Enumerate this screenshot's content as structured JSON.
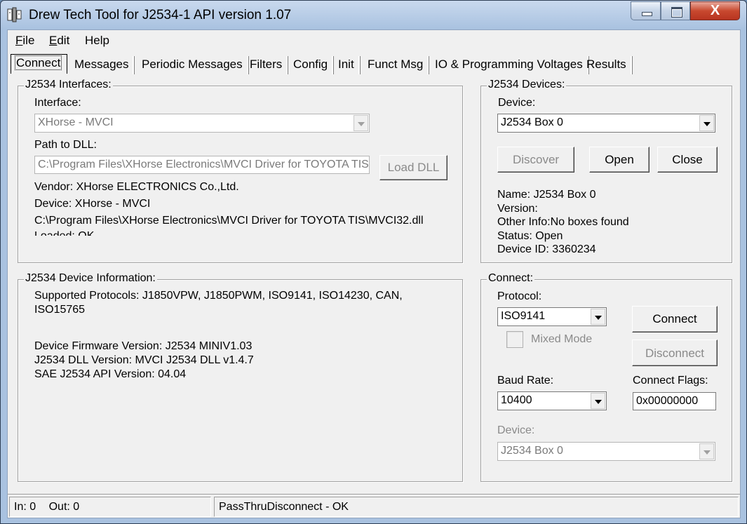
{
  "window": {
    "title": "Drew Tech Tool for J2534-1 API version 1.07",
    "close_glyph": "X"
  },
  "menu": {
    "file": "ile",
    "file_hotkey": "F",
    "edit": "dit",
    "edit_hotkey": "E",
    "help": "Help"
  },
  "tabs": [
    {
      "label": "Connect"
    },
    {
      "label": "Messages"
    },
    {
      "label": "Periodic Messages"
    },
    {
      "label": "Filters"
    },
    {
      "label": "Config"
    },
    {
      "label": "Init"
    },
    {
      "label": "Funct Msg"
    },
    {
      "label": "IO & Programming Voltages"
    },
    {
      "label": "Results"
    }
  ],
  "interfaces": {
    "group_title": "J2534 Interfaces:",
    "interface_label": "Interface:",
    "interface_value": "XHorse - MVCI",
    "path_label": "Path to DLL:",
    "path_value": "C:\\Program Files\\XHorse Electronics\\MVCI Driver for TOYOTA TIS",
    "load_dll_button": "Load DLL",
    "vendor_line": "Vendor: XHorse ELECTRONICS Co.,Ltd.",
    "device_line": "Device: XHorse - MVCI",
    "dll_path_line": "C:\\Program Files\\XHorse Electronics\\MVCI Driver for TOYOTA TIS\\MVCI32.dll",
    "loaded_line": "Loaded: OK"
  },
  "devices": {
    "group_title": "J2534 Devices:",
    "device_label": "Device:",
    "device_value": "J2534 Box 0",
    "discover_button": "Discover",
    "open_button": "Open",
    "close_button": "Close",
    "info": {
      "name": "Name: J2534 Box 0",
      "version": "Version:",
      "other": "Other Info:No boxes found",
      "status": "Status: Open",
      "device_id": "Device ID: 3360234"
    }
  },
  "device_info": {
    "group_title": "J2534 Device Information:",
    "protocols_line1": "Supported Protocols: J1850VPW, J1850PWM, ISO9141, ISO14230, CAN,",
    "protocols_line2": "ISO15765",
    "firmware": "Device Firmware Version: J2534 MINIV1.03",
    "dll_version": "J2534 DLL Version: MVCI J2534 DLL v1.4.7",
    "api_version": "SAE J2534 API Version: 04.04"
  },
  "connect": {
    "group_title": "Connect:",
    "protocol_label": "Protocol:",
    "protocol_value": "ISO9141",
    "connect_button": "Connect",
    "mixed_mode_label": "Mixed Mode",
    "disconnect_button": "Disconnect",
    "baud_label": "Baud Rate:",
    "baud_value": "10400",
    "flags_label": "Connect Flags:",
    "flags_value": "0x00000000",
    "device_label": "Device:",
    "device_value": "J2534 Box 0"
  },
  "status": {
    "in": "In: 0",
    "out": "Out: 0",
    "message": "PassThruDisconnect - OK"
  }
}
